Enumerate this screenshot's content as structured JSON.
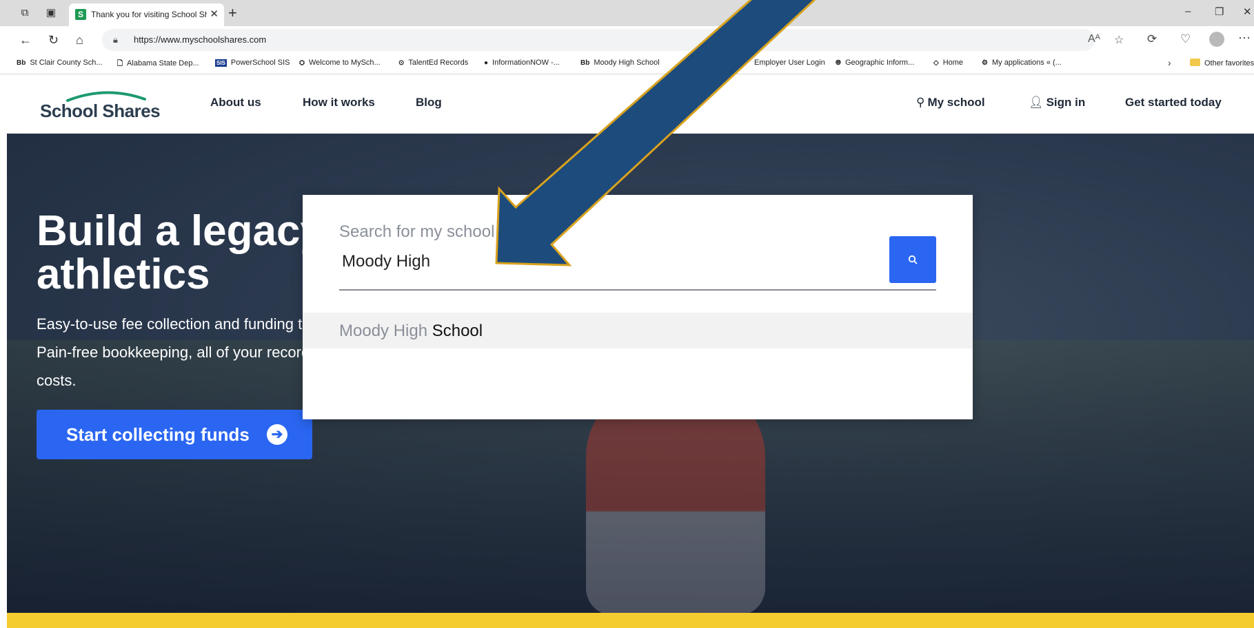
{
  "browser": {
    "tab_title": "Thank you for visiting School Shares",
    "tab_favicon": "S",
    "url": "https://www.myschoolshares.com",
    "bookmarks": [
      {
        "icon": "Bb",
        "label": "St Clair County Sch..."
      },
      {
        "icon": "page-icon",
        "label": "Alabama State Dep..."
      },
      {
        "icon": "SIS",
        "label": "PowerSchool SIS"
      },
      {
        "icon": "globe-icon",
        "label": "Welcome to MySch..."
      },
      {
        "icon": "record-icon",
        "label": "TalentEd Records"
      },
      {
        "icon": "info-icon",
        "label": "InformationNOW -..."
      },
      {
        "icon": "Bb",
        "label": "Moody High School"
      },
      {
        "icon": "",
        "label": "Employer User Login"
      },
      {
        "icon": "globe-icon",
        "label": "Geographic Inform..."
      },
      {
        "icon": "home-icon",
        "label": "Home"
      },
      {
        "icon": "gear-icon",
        "label": "My applications « (..."
      }
    ],
    "other_favorites": "Other favorites"
  },
  "site": {
    "logo_text": "School Shares",
    "nav": {
      "about": "About us",
      "how": "How it works",
      "blog": "Blog",
      "my_school": "My school",
      "sign_in": "Sign in",
      "get_started": "Get started today"
    },
    "hero": {
      "title": "Build a legacy for arts & athletics",
      "description": "Easy-to-use fee collection and funding tools for arts and athletics programs at US schools. Pain-free bookkeeping, all of your records in one place (year after year), and zero upfront costs.",
      "cta": "Start collecting funds"
    },
    "search": {
      "label": "Search for my school",
      "value": "Moody High",
      "result_match": "Moody High",
      "result_rest": " School"
    }
  },
  "colors": {
    "brand_blue": "#2a66f2",
    "arrow_fill": "#1d4b7c",
    "arrow_stroke": "#d8a21e",
    "band_yellow": "#f4cc2f",
    "logo_green": "#1e9a6e"
  }
}
